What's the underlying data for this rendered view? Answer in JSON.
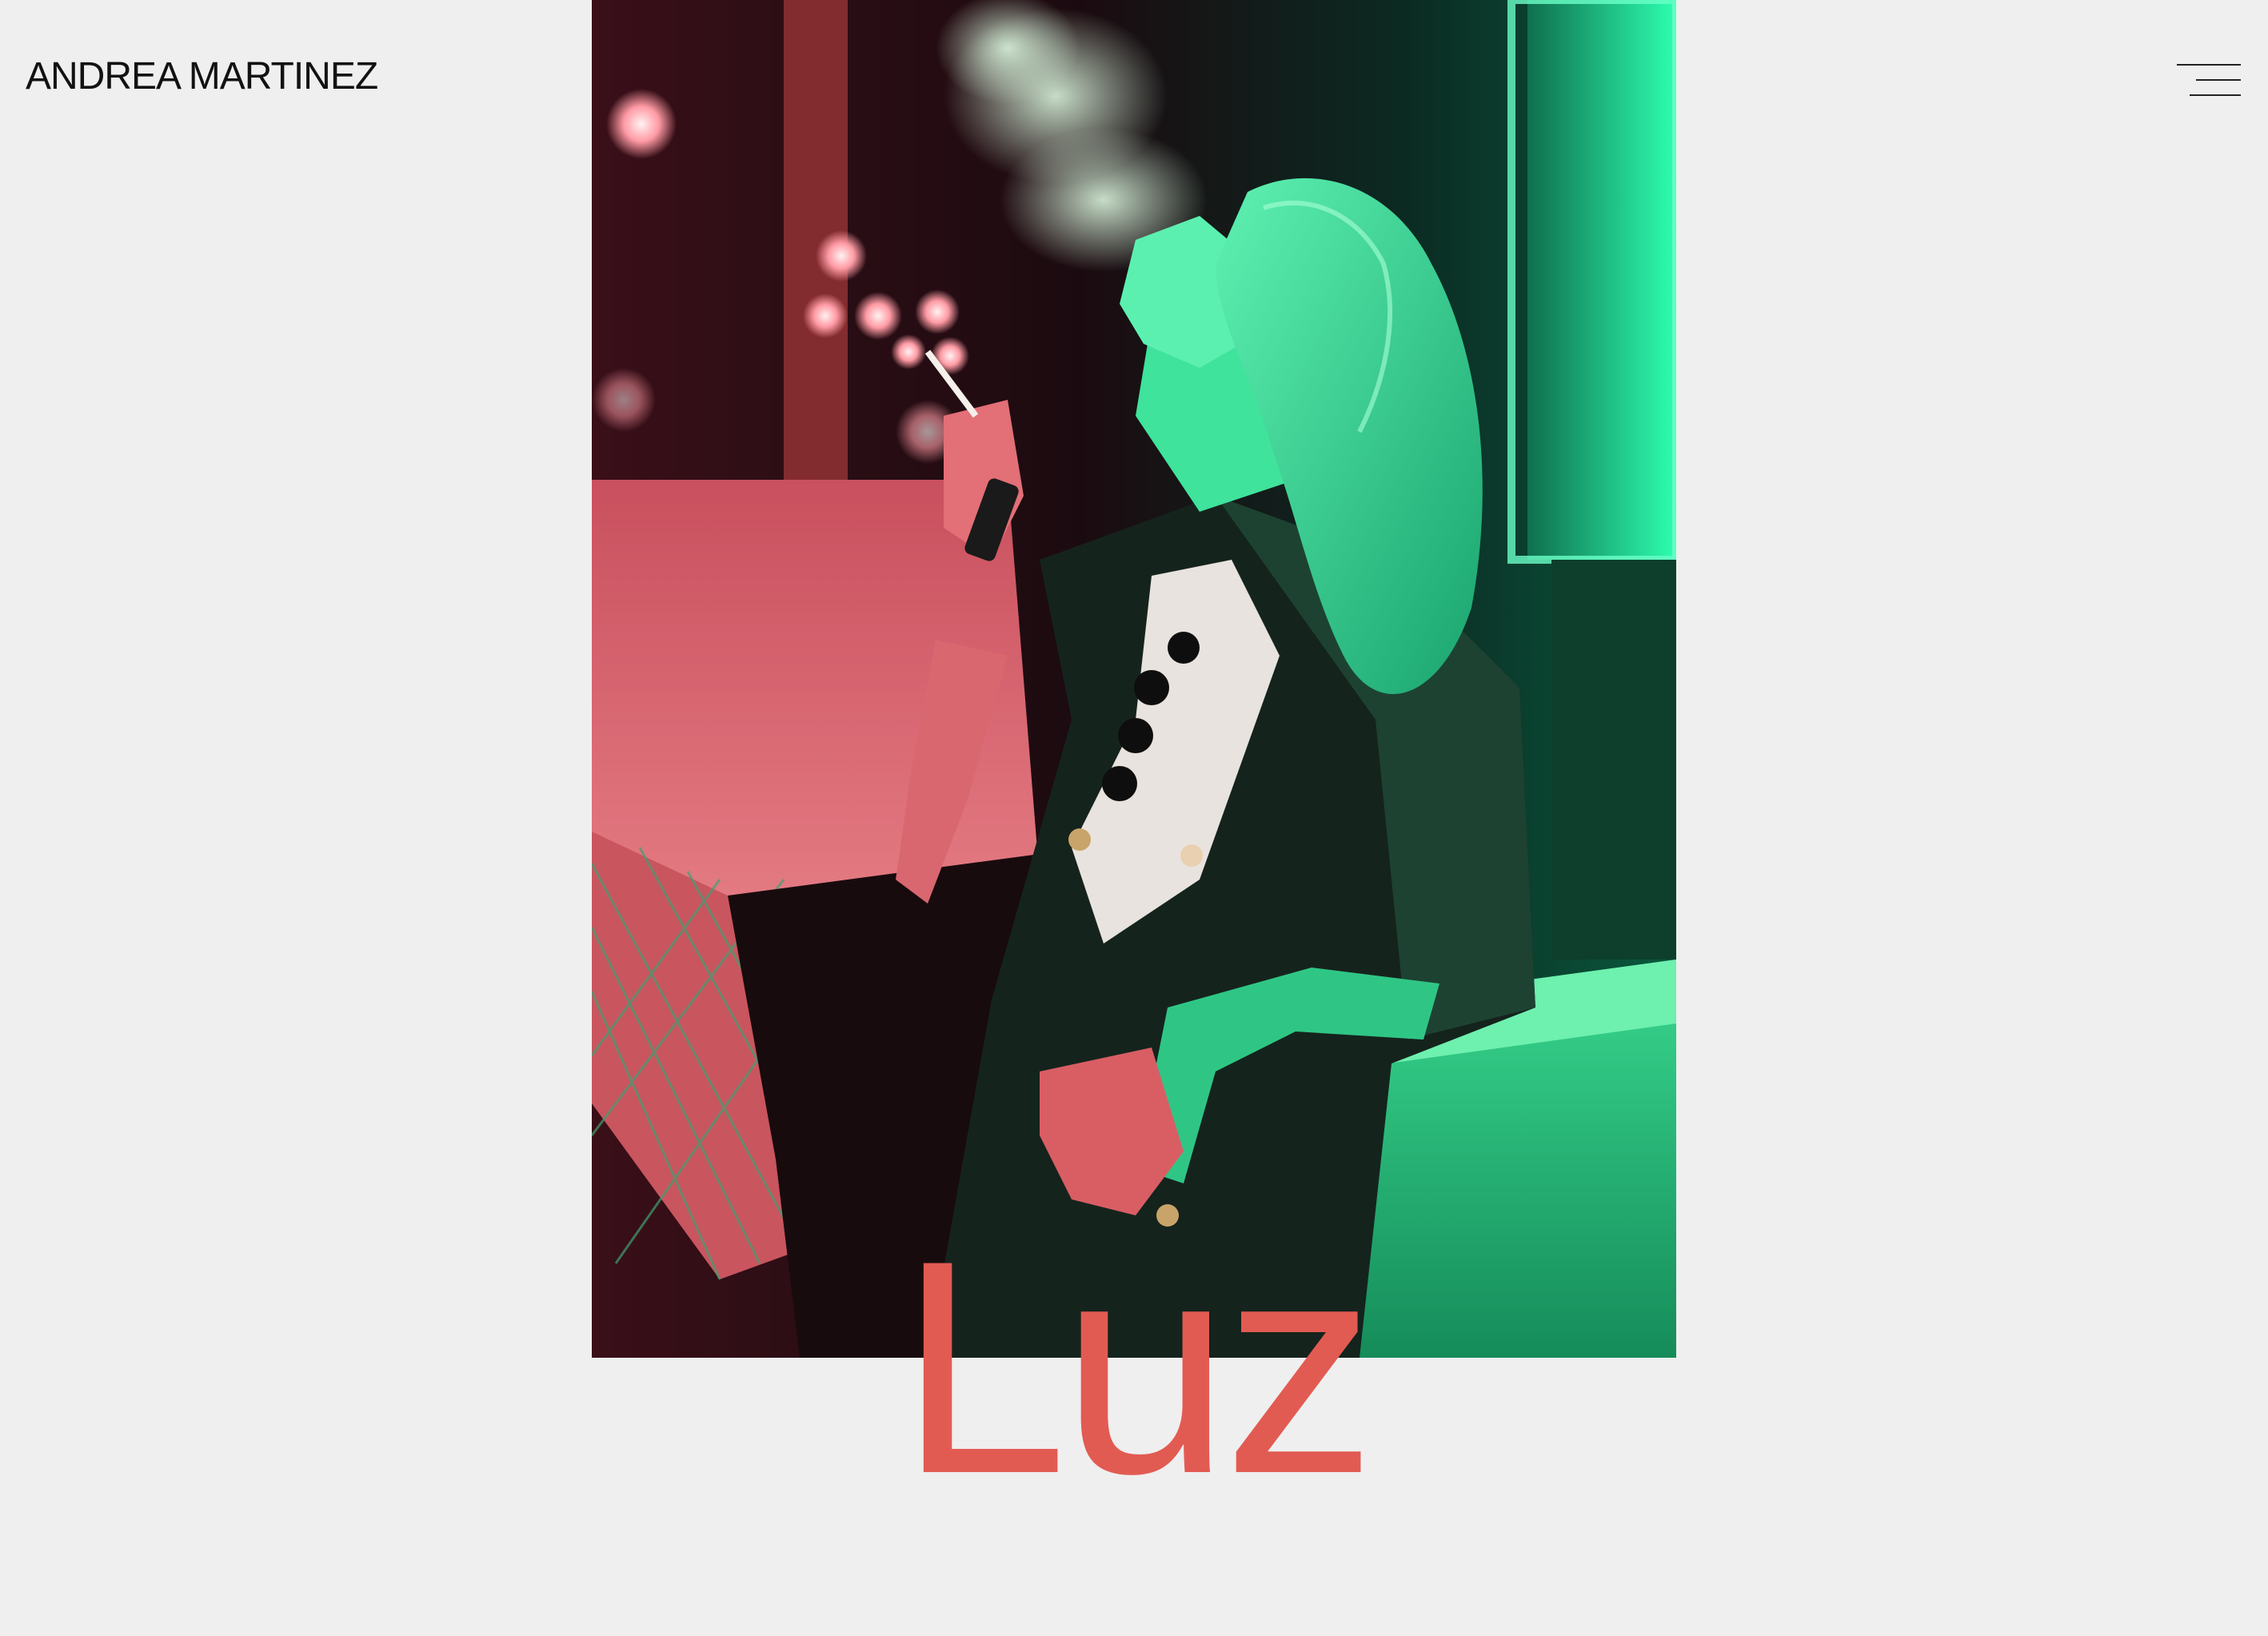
{
  "header": {
    "brand": "ANDREA MARTINEZ",
    "menu_icon": "hamburger-menu-icon"
  },
  "hero": {
    "image_alt": "Woman smoking a cigarette under green neon light at night",
    "title": "Luz"
  },
  "colors": {
    "background": "#efefef",
    "title_accent": "#e25b52",
    "text": "#121212",
    "neon_green": "#18d98c",
    "neon_pink": "#e85a6a"
  }
}
